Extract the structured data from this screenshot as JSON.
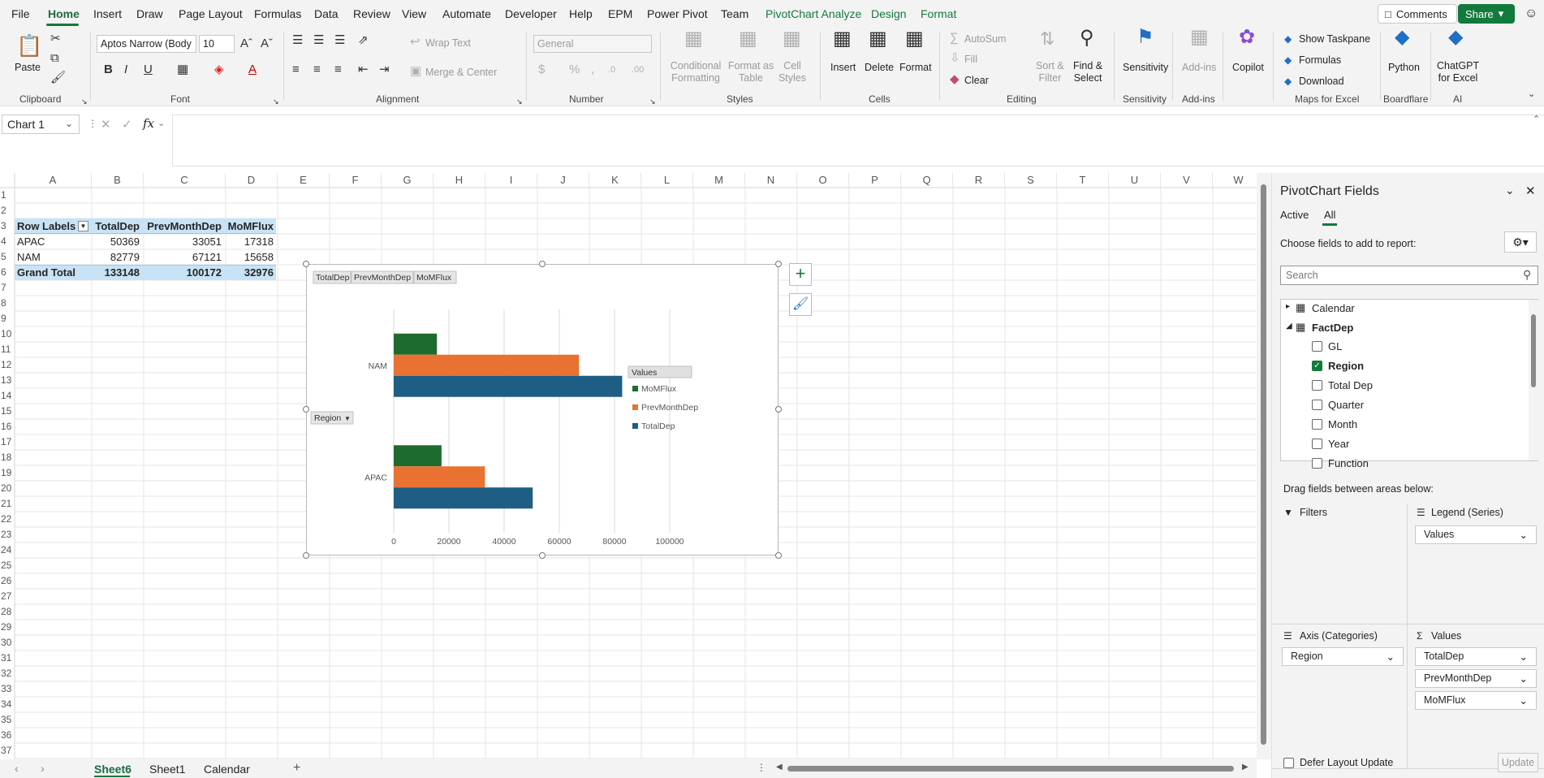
{
  "menu": {
    "items": [
      "File",
      "Home",
      "Insert",
      "Draw",
      "Page Layout",
      "Formulas",
      "Data",
      "Review",
      "View",
      "Automate",
      "Developer",
      "Help",
      "EPM",
      "Power Pivot",
      "Team",
      "PivotChart Analyze",
      "Design",
      "Format"
    ],
    "comments": "Comments",
    "share": "Share"
  },
  "ribbon": {
    "clipboard": {
      "paste": "Paste",
      "label": "Clipboard"
    },
    "font": {
      "name": "Aptos Narrow (Body",
      "size": "10",
      "label": "Font"
    },
    "alignment": {
      "wrap": "Wrap Text",
      "merge": "Merge & Center",
      "label": "Alignment"
    },
    "number": {
      "format": "General",
      "label": "Number"
    },
    "styles": {
      "cond": "Conditional",
      "cond2": "Formatting",
      "fmt": "Format as",
      "fmt2": "Table",
      "cell": "Cell",
      "cell2": "Styles",
      "label": "Styles"
    },
    "cells": {
      "insert": "Insert",
      "delete": "Delete",
      "format": "Format",
      "label": "Cells"
    },
    "editing": {
      "autosum": "AutoSum",
      "fill": "Fill",
      "clear": "Clear",
      "sort": "Sort &",
      "sort2": "Filter",
      "find": "Find &",
      "find2": "Select",
      "label": "Editing"
    },
    "sensitivity": {
      "btn": "Sensitivity",
      "label": "Sensitivity"
    },
    "addins": {
      "btn": "Add-ins",
      "label": "Add-ins"
    },
    "copilot": {
      "btn": "Copilot"
    },
    "maps": {
      "taskpane": "Show Taskpane",
      "formulas": "Formulas",
      "download": "Download",
      "label": "Maps for Excel"
    },
    "boardflare": {
      "btn": "Python",
      "label": "Boardflare"
    },
    "ai": {
      "btn": "ChatGPT",
      "btn2": "for Excel",
      "label": "AI"
    }
  },
  "formula_bar": {
    "name_box": "Chart 1",
    "fx": "fx"
  },
  "columns": [
    "A",
    "B",
    "C",
    "D",
    "E",
    "F",
    "G",
    "H",
    "I",
    "J",
    "K",
    "L",
    "M",
    "N",
    "O",
    "P",
    "Q",
    "R",
    "S",
    "T",
    "U",
    "V",
    "W"
  ],
  "rows": [
    "1",
    "2",
    "3",
    "4",
    "5",
    "6",
    "7",
    "8",
    "9",
    "10",
    "11",
    "12",
    "13",
    "14",
    "15",
    "16",
    "17",
    "18",
    "19",
    "20",
    "21",
    "22",
    "23",
    "24",
    "25",
    "26",
    "27",
    "28",
    "29",
    "30",
    "31",
    "32",
    "33",
    "34",
    "35",
    "36",
    "37"
  ],
  "pivot_table": {
    "headers": [
      "Row Labels",
      "TotalDep",
      "PrevMonthDep",
      "MoMFlux"
    ],
    "rows": [
      [
        "APAC",
        "50369",
        "33051",
        "17318"
      ],
      [
        "NAM",
        "82779",
        "67121",
        "15658"
      ]
    ],
    "total": [
      "Grand Total",
      "133148",
      "100172",
      "32976"
    ]
  },
  "chart_data": {
    "type": "bar",
    "orientation": "horizontal",
    "categories": [
      "APAC",
      "NAM"
    ],
    "series": [
      {
        "name": "TotalDep",
        "values": [
          50369,
          82779
        ],
        "color": "#1f5e84"
      },
      {
        "name": "PrevMonthDep",
        "values": [
          33051,
          67121
        ],
        "color": "#e97132"
      },
      {
        "name": "MoMFlux",
        "values": [
          17318,
          15658
        ],
        "color": "#1e6b2e"
      }
    ],
    "xlim": [
      0,
      100000
    ],
    "ticks": [
      "0",
      "20000",
      "40000",
      "60000",
      "80000",
      "100000"
    ],
    "legend_title": "Values",
    "legend_position": "right",
    "field_buttons": [
      "TotalDep",
      "PrevMonthDep",
      "MoMFlux"
    ],
    "axis_button": "Region",
    "grid": true
  },
  "pane": {
    "title": "PivotChart Fields",
    "tabs": [
      "Active",
      "All"
    ],
    "choose": "Choose fields to add to report:",
    "search_placeholder": "Search",
    "tables": [
      "Calendar",
      "FactDep"
    ],
    "fields": [
      {
        "name": "GL",
        "checked": false
      },
      {
        "name": "Region",
        "checked": true
      },
      {
        "name": "Total Dep",
        "checked": false
      },
      {
        "name": "Quarter",
        "checked": false
      },
      {
        "name": "Month",
        "checked": false
      },
      {
        "name": "Year",
        "checked": false
      },
      {
        "name": "Function",
        "checked": false
      }
    ],
    "drag": "Drag fields between areas below:",
    "filters": "Filters",
    "legend": "Legend (Series)",
    "legend_items": [
      "Values"
    ],
    "axis": "Axis (Categories)",
    "axis_items": [
      "Region"
    ],
    "values": "Values",
    "values_items": [
      "TotalDep",
      "PrevMonthDep",
      "MoMFlux"
    ],
    "defer": "Defer Layout Update",
    "update": "Update"
  },
  "sheets": [
    "Sheet6",
    "Sheet1",
    "Calendar"
  ]
}
